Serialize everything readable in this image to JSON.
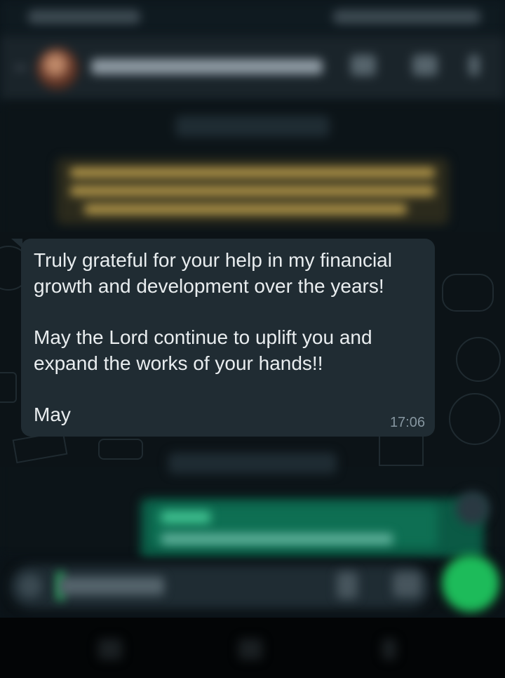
{
  "message": {
    "lines": [
      "Truly grateful for your help in my financial",
      "growth and development over the years!",
      "",
      "May the Lord continue to uplift you and",
      "expand the works of your hands!!",
      "",
      "May"
    ],
    "time": "17:06"
  },
  "colors": {
    "bubble_incoming": "#202c33",
    "chat_background": "#0b141a",
    "accent_green": "#25d366",
    "timestamp": "#8696a0"
  },
  "icons": [
    "back-arrow-icon",
    "video-call-icon",
    "phone-icon",
    "more-options-icon",
    "emoji-icon",
    "attach-icon",
    "camera-icon",
    "mic-icon",
    "scroll-down-icon"
  ]
}
